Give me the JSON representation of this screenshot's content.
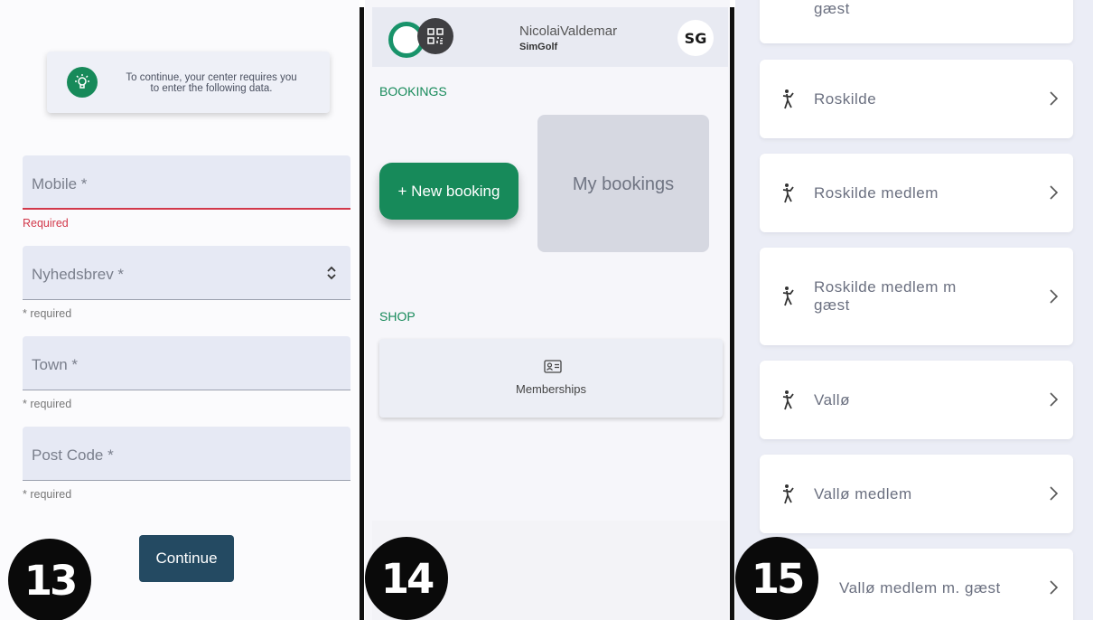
{
  "panel13": {
    "badge": "13",
    "notice_text": "To continue, your center requires you to enter the following data.",
    "fields": [
      {
        "label": "Mobile *",
        "helper": "Required",
        "error": true
      },
      {
        "label": "Nyhedsbrev *",
        "helper": "* required",
        "select": true
      },
      {
        "label": "Town *",
        "helper": "* required"
      },
      {
        "label": "Post Code *",
        "helper": "* required"
      }
    ],
    "continue_label": "Continue",
    "icon": "lightbulb-icon",
    "accent_color": "#178a5a",
    "error_color": "#d2384a"
  },
  "panel14": {
    "badge": "14",
    "user_name": "NicolaiValdemar",
    "center_name": "SimGolf",
    "center_logo_text": "SG",
    "bookings_title": "BOOKINGS",
    "new_booking_label": "+ New booking",
    "my_bookings_label": "My bookings",
    "shop_title": "SHOP",
    "memberships_label": "Memberships",
    "accent_color": "#178a5a"
  },
  "panel15": {
    "badge": "15",
    "top_partial": "gæst",
    "rates": [
      {
        "label": "Roskilde"
      },
      {
        "label": "Roskilde medlem"
      },
      {
        "label": "Roskilde medlem m gæst"
      },
      {
        "label": "Vallø"
      },
      {
        "label": "Vallø medlem"
      },
      {
        "label": "Vallø medlem m. gæst"
      }
    ],
    "icon": "golfer-icon"
  }
}
